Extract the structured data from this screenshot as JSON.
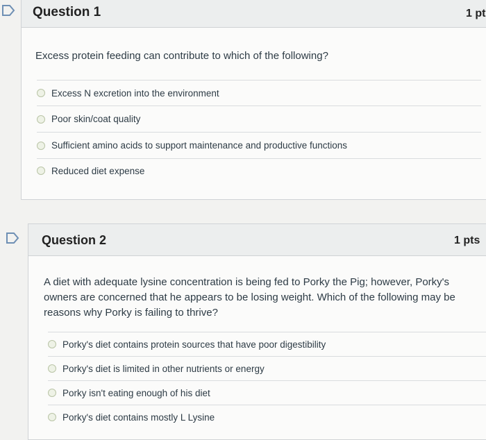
{
  "questions": [
    {
      "title": "Question 1",
      "points": "1 pt",
      "text": "Excess protein feeding can contribute to which of the following?",
      "answers": [
        "Excess N excretion into the environment",
        "Poor skin/coat quality",
        "Sufficient amino acids to support maintenance and productive functions",
        "Reduced diet expense"
      ]
    },
    {
      "title": "Question 2",
      "points": "1 pts",
      "text": "A diet with adequate lysine concentration is being fed to Porky the Pig; however, Porky's owners are concerned that he appears to be losing weight. Which of the following may be reasons why Porky is failing to thrive?",
      "answers": [
        "Porky's diet contains protein sources that have poor digestibility",
        "Porky's diet is limited in other nutrients or energy",
        "Porky isn't eating enough of his diet",
        "Porky's diet contains mostly L Lysine"
      ]
    }
  ],
  "colors": {
    "accent": "#6e8fb4",
    "radio_border": "#b9c4a6"
  },
  "icons": {
    "flag": "flag-icon"
  }
}
